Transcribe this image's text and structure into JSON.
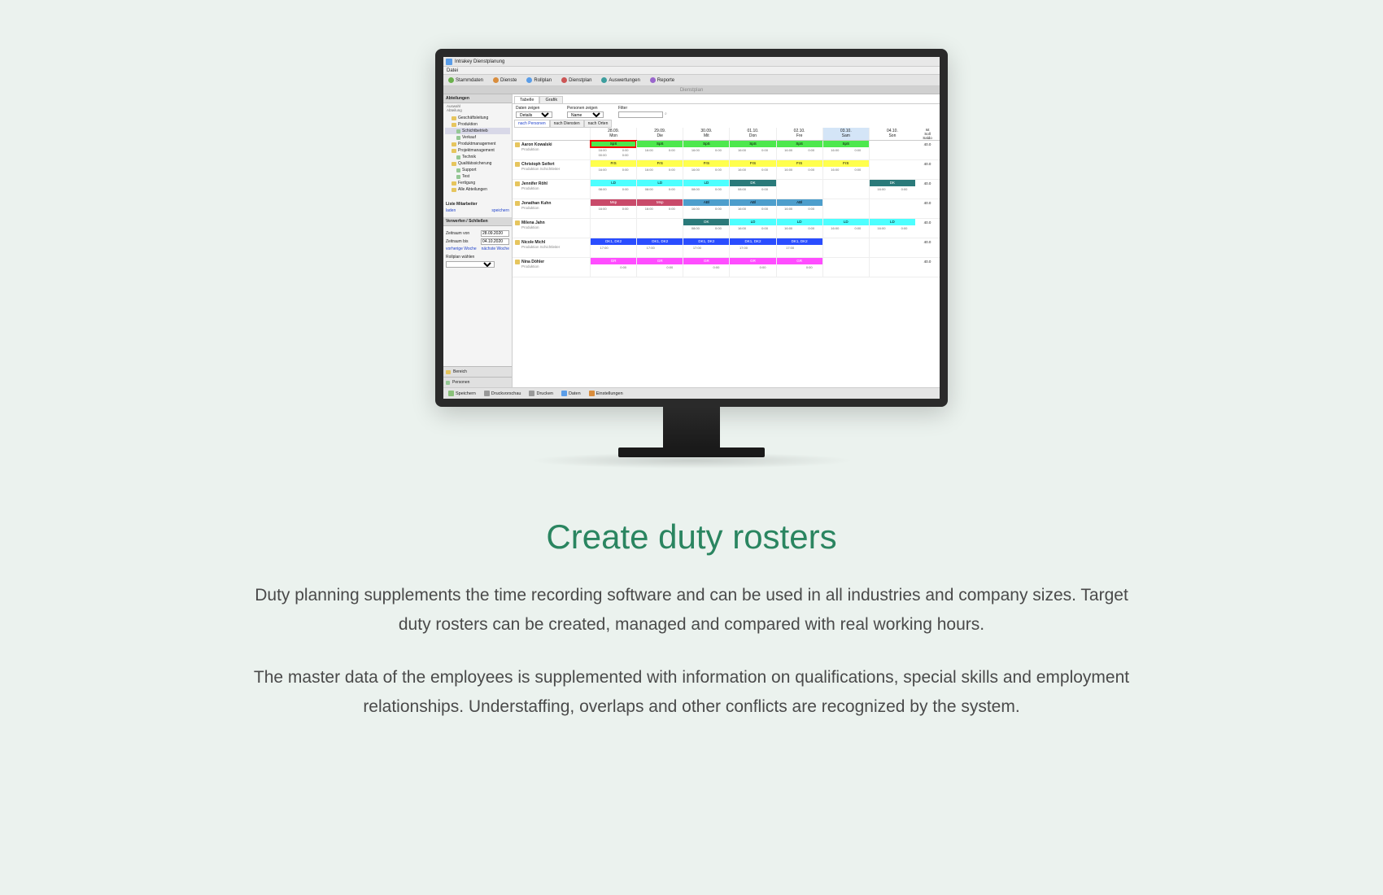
{
  "page": {
    "title": "Create duty rosters",
    "para1": "Duty planning supplements the time recording software and can be used in all industries and company sizes. Target duty rosters can be created, managed and compared with real working hours.",
    "para2": "The master data of the employees is supplemented with information on qualifications, special skills and employment relationships. Understaffing, overlaps and other conflicts are recognized by the system."
  },
  "app": {
    "title": "Intrakey Dienstplanung",
    "menu": "Datei",
    "ribbon_label": "Dienstplan",
    "toolbar": [
      {
        "label": "Stammdaten",
        "color": "tb-green"
      },
      {
        "label": "Dienste",
        "color": "tb-orange"
      },
      {
        "label": "Rollplan",
        "color": "tb-blue"
      },
      {
        "label": "Dienstplan",
        "color": "tb-red"
      },
      {
        "label": "Auswertungen",
        "color": "tb-teal"
      },
      {
        "label": "Reporte",
        "color": "tb-purple"
      }
    ],
    "bottom_toolbar": [
      {
        "label": "Speichern"
      },
      {
        "label": "Druckvorschau"
      },
      {
        "label": "Drucken"
      },
      {
        "label": "Daten"
      },
      {
        "label": "Einstellungen"
      }
    ]
  },
  "sidebar": {
    "header": "Abteilungen",
    "sub1": "Auswahl",
    "sub2": "Abteilung",
    "tree": {
      "n0": "Geschäftsleitung",
      "n1": "Produktion",
      "n1a": "Schichtbetrieb",
      "n1b": "Verkauf",
      "n2": "Produktmanagement",
      "n3": "Projektmanagement",
      "n3a": "Technik",
      "n4": "Qualitätssicherung",
      "n4a": "Support",
      "n4b": "Test",
      "n5": "Fertigung",
      "n6": "Alle Abteilungen"
    },
    "list_header": "Liste Mitarbeiter",
    "load": "laden",
    "save": "speichern",
    "section2_header": "Verwerfen / Schließen",
    "from_label": "Zeitraum von",
    "from_value": "28.09.2020",
    "to_label": "Zeitraum bis",
    "to_value": "04.10.2020",
    "prev_week": "vorherige Woche",
    "next_week": "nächste Woche",
    "rollplan": "Rollplan wählen",
    "footer1": "Bereich",
    "footer2": "Personen"
  },
  "main": {
    "tabs": {
      "t1": "Tabelle",
      "t2": "Grafik"
    },
    "filters": {
      "show_label": "Daten zeigen",
      "show_value": "Details",
      "person_label": "Personen zeigen",
      "person_value": "Name",
      "filter_label": "Filter"
    },
    "subtabs": {
      "s1": "nach Personen",
      "s2": "nach Diensten",
      "s3": "nach Orten"
    },
    "days": [
      {
        "date": "28.09.",
        "name": "Mon"
      },
      {
        "date": "29.09.",
        "name": "Die"
      },
      {
        "date": "30.09.",
        "name": "Mit"
      },
      {
        "date": "01.10.",
        "name": "Don"
      },
      {
        "date": "02.10.",
        "name": "Fre"
      },
      {
        "date": "03.10.",
        "name": "Sam"
      },
      {
        "date": "04.10.",
        "name": "Son"
      }
    ],
    "stat_header": {
      "c1": "Ist",
      "c2": "Soll",
      "c3": "Saldo"
    },
    "people": [
      {
        "name": "Aaron Kowalski",
        "dept": "Produktion",
        "total": "40.0",
        "shifts": [
          {
            "label": "SpS",
            "color": "shift-green",
            "t1": "16:00",
            "t2": "0:00",
            "t3": "00:00",
            "t4": "0:00",
            "hl": true
          },
          {
            "label": "SpS",
            "color": "shift-green",
            "t1": "16:00",
            "t2": "0:00"
          },
          {
            "label": "SpS",
            "color": "shift-green",
            "t1": "16:00",
            "t2": "0:00"
          },
          {
            "label": "SpS",
            "color": "shift-green",
            "t1": "16:00",
            "t2": "0:00"
          },
          {
            "label": "SpS",
            "color": "shift-green",
            "t1": "16:00",
            "t2": "0:00"
          },
          {
            "label": "SpS",
            "color": "shift-green",
            "t1": "16:00",
            "t2": "0:00"
          },
          null
        ]
      },
      {
        "name": "Christoph Seifert",
        "dept": "Produktion Schichtleiter",
        "total": "40.0",
        "shifts": [
          {
            "label": "FrS",
            "color": "shift-yellow",
            "t1": "16:00",
            "t2": "0:00"
          },
          {
            "label": "FrS",
            "color": "shift-yellow",
            "t1": "16:00",
            "t2": "0:00"
          },
          {
            "label": "FrS",
            "color": "shift-yellow",
            "t1": "16:00",
            "t2": "0:00"
          },
          {
            "label": "FrS",
            "color": "shift-yellow",
            "t1": "16:00",
            "t2": "0:00"
          },
          {
            "label": "FrS",
            "color": "shift-yellow",
            "t1": "16:00",
            "t2": "0:00"
          },
          {
            "label": "FrS",
            "color": "shift-yellow",
            "t1": "16:00",
            "t2": "0:00"
          },
          null
        ]
      },
      {
        "name": "Jennifer Röhl",
        "dept": "Produktion",
        "total": "40.0",
        "shifts": [
          {
            "label": "LD",
            "color": "shift-cyan",
            "t1": "08:00",
            "t2": "0:00"
          },
          {
            "label": "LD",
            "color": "shift-cyan",
            "t1": "08:00",
            "t2": "0:00"
          },
          {
            "label": "LD",
            "color": "shift-cyan",
            "t1": "08:00",
            "t2": "0:00"
          },
          {
            "label": "DK",
            "color": "shift-teal",
            "t1": "08:00",
            "t2": "0:00"
          },
          null,
          null,
          {
            "label": "DK",
            "color": "shift-teal",
            "t1": "16:00",
            "t2": "0:00"
          }
        ]
      },
      {
        "name": "Jonathan Kuhn",
        "dept": "Produktion",
        "total": "40.0",
        "shifts": [
          {
            "label": "Msp",
            "color": "shift-crimson",
            "t1": "16:00",
            "t2": "0:00"
          },
          {
            "label": "Msp",
            "color": "shift-crimson",
            "t1": "16:00",
            "t2": "0:00"
          },
          {
            "label": "ABl",
            "color": "shift-steelblue",
            "t1": "16:00",
            "t2": "0:00"
          },
          {
            "label": "ABl",
            "color": "shift-steelblue",
            "t1": "16:00",
            "t2": "0:00"
          },
          {
            "label": "ABl",
            "color": "shift-steelblue",
            "t1": "16:00",
            "t2": "0:00"
          },
          null,
          null
        ]
      },
      {
        "name": "Milena Jahn",
        "dept": "Produktion",
        "total": "40.0",
        "shifts": [
          null,
          null,
          {
            "label": "DK",
            "color": "shift-teal",
            "t1": "08:00",
            "t2": "0:00"
          },
          {
            "label": "LD",
            "color": "shift-cyan",
            "t1": "16:00",
            "t2": "0:00"
          },
          {
            "label": "LD",
            "color": "shift-cyan",
            "t1": "16:00",
            "t2": "0:00"
          },
          {
            "label": "LD",
            "color": "shift-cyan",
            "t1": "16:00",
            "t2": "0:00"
          },
          {
            "label": "LD",
            "color": "shift-cyan",
            "t1": "16:00",
            "t2": "0:00"
          }
        ]
      },
      {
        "name": "Nicole Michl",
        "dept": "Produktion Schichtleiter",
        "total": "40.0",
        "shifts": [
          {
            "label": "DK1, DK2",
            "color": "shift-blue",
            "t1": "17:00",
            "t2": ""
          },
          {
            "label": "DK1, DK2",
            "color": "shift-blue",
            "t1": "17:00",
            "t2": ""
          },
          {
            "label": "DK1, DK2",
            "color": "shift-blue",
            "t1": "17:00",
            "t2": ""
          },
          {
            "label": "DK1, DK2",
            "color": "shift-blue",
            "t1": "17:00",
            "t2": ""
          },
          {
            "label": "DK1, DK2",
            "color": "shift-blue",
            "t1": "17:00",
            "t2": ""
          },
          null,
          null
        ]
      },
      {
        "name": "Nina Döhler",
        "dept": "Produktion",
        "total": "40.0",
        "shifts": [
          {
            "label": "GR",
            "color": "shift-magenta",
            "t1": "",
            "t2": "0:00"
          },
          {
            "label": "GR",
            "color": "shift-magenta",
            "t1": "",
            "t2": "0:00"
          },
          {
            "label": "GR",
            "color": "shift-magenta",
            "t1": "",
            "t2": "0:00"
          },
          {
            "label": "GR",
            "color": "shift-magenta",
            "t1": "",
            "t2": "0:00"
          },
          {
            "label": "GR",
            "color": "shift-magenta",
            "t1": "",
            "t2": "0:00"
          },
          null,
          null
        ]
      }
    ]
  }
}
